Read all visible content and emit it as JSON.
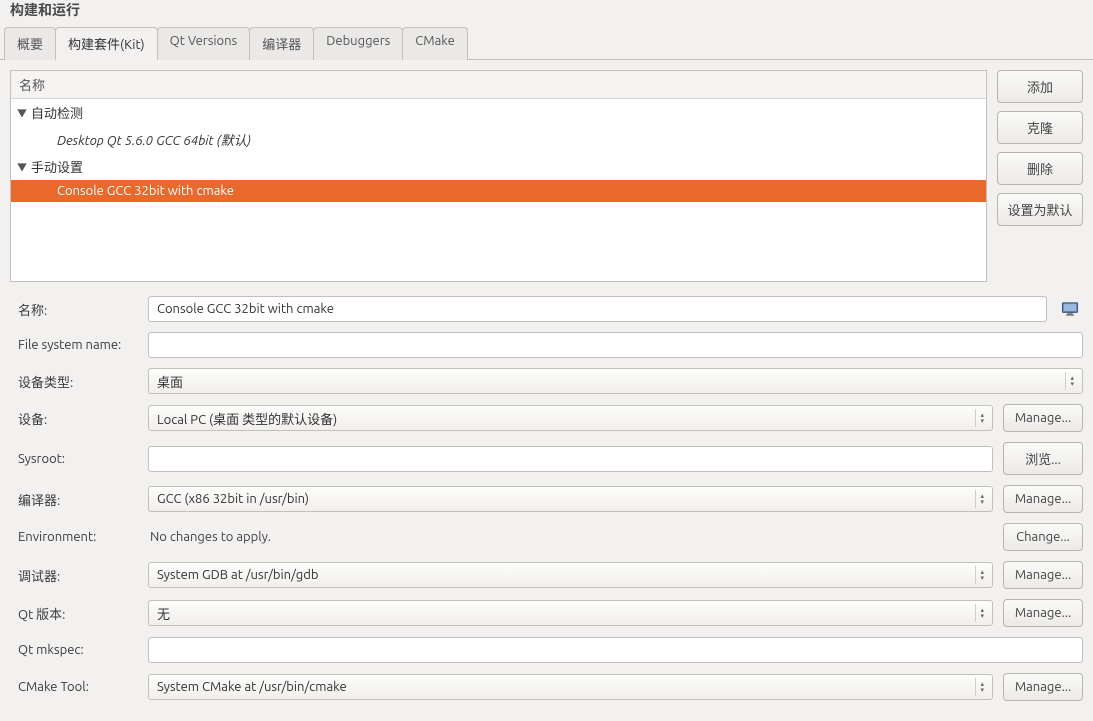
{
  "window": {
    "title": "构建和运行"
  },
  "tabs": [
    {
      "label": "概要"
    },
    {
      "label": "构建套件(Kit)"
    },
    {
      "label": "Qt Versions"
    },
    {
      "label": "编译器"
    },
    {
      "label": "Debuggers"
    },
    {
      "label": "CMake"
    }
  ],
  "tree": {
    "header": "名称",
    "group_auto": "自动检测",
    "item_auto": "Desktop Qt 5.6.0 GCC 64bit (默认)",
    "group_manual": "手动设置",
    "item_manual": "Console GCC 32bit with cmake"
  },
  "sidebar": {
    "add": "添加",
    "clone": "克隆",
    "delete": "删除",
    "set_default": "设置为默认"
  },
  "form": {
    "name_label": "名称:",
    "name_value": "Console GCC 32bit with cmake",
    "fsname_label": "File system name:",
    "fsname_value": "",
    "devtype_label": "设备类型:",
    "devtype_value": "桌面",
    "device_label": "设备:",
    "device_value": "Local PC (桌面 类型的默认设备)",
    "sysroot_label": "Sysroot:",
    "sysroot_value": "",
    "compiler_label": "编译器:",
    "compiler_value": "GCC (x86 32bit in /usr/bin)",
    "env_label": "Environment:",
    "env_value": "No changes to apply.",
    "debugger_label": "调试器:",
    "debugger_value": "System GDB at /usr/bin/gdb",
    "qtver_label": "Qt 版本:",
    "qtver_value": "无",
    "mkspec_label": "Qt mkspec:",
    "mkspec_value": "",
    "cmake_label": "CMake Tool:",
    "cmake_value": "System CMake at /usr/bin/cmake"
  },
  "buttons": {
    "manage": "Manage...",
    "browse": "浏览...",
    "change": "Change..."
  }
}
